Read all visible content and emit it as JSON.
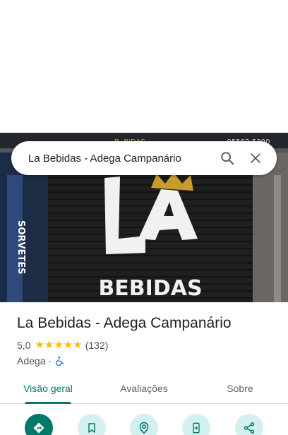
{
  "search": {
    "query": "La Bebidas - Adega Campanário",
    "search_icon": "search-icon",
    "close_icon": "close-icon"
  },
  "hero": {
    "sign_top": "B. BIDAS",
    "phone_fragment": "95582-5290",
    "logo_text": "LA",
    "logo_subtext": "BEBIDAS",
    "side_text": "SORVETES"
  },
  "place": {
    "title": "La Bebidas - Adega Campanário",
    "rating": "5,0",
    "stars": 5,
    "reviews": "(132)",
    "category": "Adega",
    "separator": "·",
    "accessibility_icon": "wheelchair-icon"
  },
  "tabs": [
    {
      "label": "Visão geral",
      "active": true
    },
    {
      "label": "Avaliações",
      "active": false
    },
    {
      "label": "Sobre",
      "active": false
    }
  ],
  "actions": [
    {
      "icon": "directions-icon"
    },
    {
      "icon": "bookmark-icon"
    },
    {
      "icon": "nearby-icon"
    },
    {
      "icon": "send-to-phone-icon"
    },
    {
      "icon": "share-icon"
    }
  ],
  "colors": {
    "accent": "#00796b",
    "accent_light": "#d2f1ee",
    "star": "#fbbc04"
  }
}
